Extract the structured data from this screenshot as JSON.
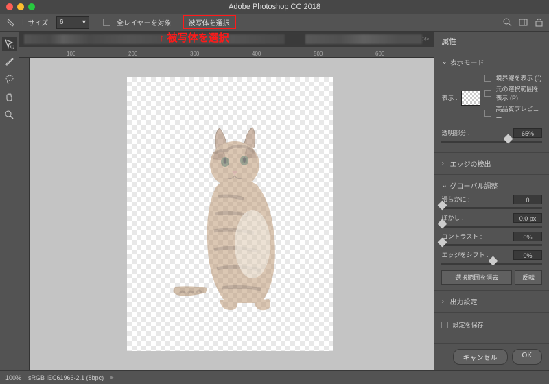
{
  "window": {
    "title": "Adobe Photoshop CC 2018"
  },
  "options": {
    "size_label": "サイズ :",
    "size_value": "6",
    "all_layers": "全レイヤーを対象",
    "select_subject": "被写体を選択"
  },
  "annotation": "↑ 被写体を選択",
  "ruler": {
    "t1": "100",
    "t2": "200",
    "t3": "300",
    "t4": "400",
    "t5": "500",
    "t6": "600"
  },
  "panel": {
    "title": "属性",
    "view_mode": "表示モード",
    "show_label": "表示 :",
    "show_edge": "境界線を表示 (J)",
    "show_original": "元の選択範囲を表示 (P)",
    "high_quality": "高品質プレビュー",
    "transparency_label": "透明部分 :",
    "transparency_value": "65%",
    "edge_detection": "エッジの検出",
    "global_adjust": "グローバル調整",
    "smooth_label": "滑らかに :",
    "smooth_value": "0",
    "feather_label": "ぼかし :",
    "feather_value": "0.0 px",
    "contrast_label": "コントラスト :",
    "contrast_value": "0%",
    "shift_label": "エッジをシフト :",
    "shift_value": "0%",
    "clear_selection": "選択範囲を消去",
    "invert": "反転",
    "output": "出力設定",
    "save_settings": "設定を保存",
    "cancel": "キャンセル",
    "ok": "OK"
  },
  "status": {
    "zoom": "100%",
    "profile": "sRGB IEC61966-2.1 (8bpc)"
  }
}
